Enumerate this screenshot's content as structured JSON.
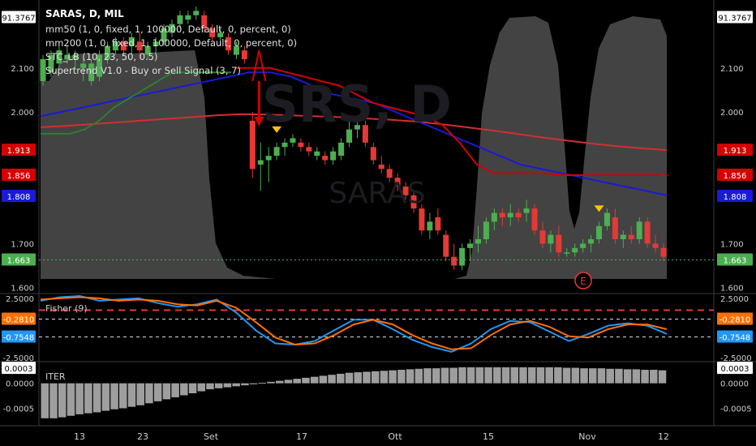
{
  "symbol": "SARAS, D, MIL",
  "watermark": {
    "big": "SRS, D",
    "small": "SARAS"
  },
  "indicators": [
    "mm50 (1, 0, fixed, 1, 100000, Default, 0, percent, 0)",
    "mm200 (1, 0, fixed, 1, 100000, Default, 0, percent, 0)",
    "STC_LB (10, 23, 50, 0.5)",
    "Supertrend V1.0 - Buy or Sell Signal (3, 7)"
  ],
  "earnings_marker": "E",
  "colors": {
    "up": "#4caf50",
    "down": "#e53935",
    "mm50": "#1a1ad8",
    "mm200": "#d32f2f",
    "supertrend_up": "#2e7d32",
    "supertrend_down": "#d50000",
    "fisher1": "#2196f3",
    "fisher2": "#ff6f00",
    "stc": "#7a7a7a",
    "iter": "#9e9e9e",
    "signal": "#ffc107"
  },
  "chart_data": [
    {
      "type": "candlestick",
      "title": "SARAS, D, MIL",
      "x_labels": [
        "13",
        "23",
        "Set",
        "17",
        "Ott",
        "15",
        "Nov",
        "12"
      ],
      "ylim": [
        1.59,
        2.24
      ],
      "y_ticks": [
        "2.100",
        "2.000",
        "1.700",
        "1.600"
      ],
      "price_labels": [
        {
          "text": "91.3767",
          "value": 2.215,
          "color": "#ffffff",
          "bg": "#ffffff",
          "fg": "#000000"
        },
        {
          "text": "1.913",
          "value": 1.913,
          "bg": "#d50000",
          "fg": "#ffffff"
        },
        {
          "text": "1.856",
          "value": 1.856,
          "bg": "#d50000",
          "fg": "#ffffff"
        },
        {
          "text": "1.808",
          "value": 1.808,
          "bg": "#1a1ad8",
          "fg": "#ffffff"
        },
        {
          "text": "1.663",
          "value": 1.663,
          "bg": "#4caf50",
          "fg": "#ffffff"
        }
      ],
      "candles": [
        [
          2.07,
          2.13,
          2.06,
          2.12
        ],
        [
          2.09,
          2.14,
          2.08,
          2.13
        ],
        [
          2.11,
          2.15,
          2.1,
          2.14
        ],
        [
          2.12,
          2.15,
          2.11,
          2.13
        ],
        [
          2.12,
          2.14,
          2.1,
          2.13
        ],
        [
          2.1,
          2.12,
          2.07,
          2.11
        ],
        [
          2.07,
          2.12,
          2.06,
          2.11
        ],
        [
          2.08,
          2.14,
          2.07,
          2.13
        ],
        [
          2.12,
          2.16,
          2.11,
          2.15
        ],
        [
          2.14,
          2.17,
          2.13,
          2.16
        ],
        [
          2.16,
          2.17,
          2.13,
          2.14
        ],
        [
          2.15,
          2.18,
          2.13,
          2.17
        ],
        [
          2.16,
          2.18,
          2.12,
          2.14
        ],
        [
          2.13,
          2.16,
          2.12,
          2.15
        ],
        [
          2.15,
          2.17,
          2.13,
          2.16
        ],
        [
          2.16,
          2.2,
          2.15,
          2.19
        ],
        [
          2.18,
          2.21,
          2.17,
          2.2
        ],
        [
          2.2,
          2.23,
          2.19,
          2.22
        ],
        [
          2.21,
          2.23,
          2.2,
          2.22
        ],
        [
          2.22,
          2.24,
          2.21,
          2.23
        ],
        [
          2.22,
          2.23,
          2.18,
          2.19
        ],
        [
          2.19,
          2.2,
          2.16,
          2.17
        ],
        [
          2.17,
          2.19,
          2.15,
          2.18
        ],
        [
          2.17,
          2.18,
          2.13,
          2.14
        ],
        [
          2.13,
          2.16,
          2.12,
          2.15
        ],
        [
          2.14,
          2.15,
          2.11,
          2.12
        ],
        [
          1.98,
          2.0,
          1.85,
          1.87
        ],
        [
          1.88,
          1.93,
          1.82,
          1.89
        ],
        [
          1.89,
          1.92,
          1.84,
          1.9
        ],
        [
          1.9,
          1.93,
          1.89,
          1.92
        ],
        [
          1.92,
          1.94,
          1.9,
          1.93
        ],
        [
          1.93,
          1.95,
          1.92,
          1.94
        ],
        [
          1.93,
          1.94,
          1.91,
          1.92
        ],
        [
          1.92,
          1.93,
          1.9,
          1.91
        ],
        [
          1.9,
          1.92,
          1.89,
          1.91
        ],
        [
          1.9,
          1.91,
          1.88,
          1.89
        ],
        [
          1.89,
          1.92,
          1.88,
          1.91
        ],
        [
          1.9,
          1.94,
          1.89,
          1.93
        ],
        [
          1.93,
          1.98,
          1.92,
          1.96
        ],
        [
          1.96,
          1.98,
          1.94,
          1.97
        ],
        [
          1.97,
          1.98,
          1.92,
          1.93
        ],
        [
          1.92,
          1.93,
          1.88,
          1.89
        ],
        [
          1.88,
          1.9,
          1.86,
          1.87
        ],
        [
          1.87,
          1.88,
          1.84,
          1.85
        ],
        [
          1.85,
          1.86,
          1.82,
          1.83
        ],
        [
          1.83,
          1.84,
          1.8,
          1.81
        ],
        [
          1.81,
          1.82,
          1.77,
          1.78
        ],
        [
          1.78,
          1.79,
          1.72,
          1.73
        ],
        [
          1.73,
          1.77,
          1.71,
          1.75
        ],
        [
          1.76,
          1.78,
          1.72,
          1.73
        ],
        [
          1.72,
          1.73,
          1.66,
          1.67
        ],
        [
          1.67,
          1.7,
          1.64,
          1.65
        ],
        [
          1.65,
          1.7,
          1.64,
          1.69
        ],
        [
          1.69,
          1.71,
          1.66,
          1.7
        ],
        [
          1.7,
          1.74,
          1.68,
          1.71
        ],
        [
          1.71,
          1.76,
          1.7,
          1.75
        ],
        [
          1.75,
          1.78,
          1.73,
          1.77
        ],
        [
          1.77,
          1.78,
          1.74,
          1.76
        ],
        [
          1.76,
          1.79,
          1.74,
          1.77
        ],
        [
          1.77,
          1.78,
          1.75,
          1.76
        ],
        [
          1.77,
          1.8,
          1.75,
          1.78
        ],
        [
          1.78,
          1.79,
          1.72,
          1.73
        ],
        [
          1.73,
          1.75,
          1.69,
          1.7
        ],
        [
          1.7,
          1.73,
          1.68,
          1.72
        ],
        [
          1.72,
          1.74,
          1.67,
          1.68
        ],
        [
          1.68,
          1.69,
          1.67,
          1.68
        ],
        [
          1.68,
          1.7,
          1.67,
          1.69
        ],
        [
          1.69,
          1.71,
          1.68,
          1.7
        ],
        [
          1.7,
          1.72,
          1.68,
          1.71
        ],
        [
          1.71,
          1.75,
          1.7,
          1.74
        ],
        [
          1.74,
          1.78,
          1.73,
          1.77
        ],
        [
          1.76,
          1.78,
          1.7,
          1.71
        ],
        [
          1.71,
          1.73,
          1.69,
          1.72
        ],
        [
          1.72,
          1.74,
          1.7,
          1.71
        ],
        [
          1.71,
          1.76,
          1.7,
          1.75
        ],
        [
          1.75,
          1.76,
          1.69,
          1.7
        ],
        [
          1.7,
          1.72,
          1.68,
          1.69
        ],
        [
          1.69,
          1.7,
          1.66,
          1.67
        ]
      ],
      "mm50": [
        1.99,
        2.0,
        2.01,
        2.02,
        2.03,
        2.04,
        2.05,
        2.06,
        2.07,
        2.08,
        2.09,
        2.09,
        2.08,
        2.06,
        2.04,
        2.03,
        2.02,
        2.0,
        1.98,
        1.96,
        1.94,
        1.92,
        1.9,
        1.88,
        1.87,
        1.86,
        1.85,
        1.84,
        1.83,
        1.82,
        1.81
      ],
      "mm200": [
        1.965,
        1.968,
        1.972,
        1.976,
        1.98,
        1.984,
        1.988,
        1.992,
        1.995,
        1.994,
        1.992,
        1.99,
        1.988,
        1.985,
        1.982,
        1.978,
        1.972,
        1.965,
        1.958,
        1.95,
        1.942,
        1.935,
        1.928,
        1.922,
        1.917,
        1.913
      ],
      "supertrend": {
        "up": [
          1.95,
          1.95,
          1.95,
          1.96,
          1.98,
          2.01,
          2.03,
          2.05,
          2.07,
          2.09,
          2.09,
          2.09,
          2.09,
          2.09
        ],
        "down": [
          2.1,
          2.1,
          2.1,
          2.09,
          2.08,
          2.07,
          2.06,
          2.04,
          2.02,
          2.01,
          2.0,
          1.99,
          1.97,
          1.93,
          1.88,
          1.86,
          1.86,
          1.86,
          1.86,
          1.856,
          1.856,
          1.856,
          1.856,
          1.856,
          1.856,
          1.856
        ]
      },
      "signals": {
        "sell": [
          19,
          29,
          69
        ],
        "big_sell_arrow": 26
      }
    },
    {
      "type": "line",
      "title": "Fisher (9)",
      "ylim": [
        -2.7,
        2.7
      ],
      "y_ticks": [
        "2.5000",
        "-2.5000"
      ],
      "levels": [
        1.5,
        0.75,
        -0.75
      ],
      "price_labels": [
        {
          "text": "-0.2810",
          "value": 0.75,
          "bg": "#ff6f00",
          "fg": "#ffffff"
        },
        {
          "text": "-0.7548",
          "value": -0.75,
          "bg": "#2196f3",
          "fg": "#ffffff"
        }
      ],
      "series": [
        {
          "name": "Fisher",
          "values": [
            2.3,
            2.6,
            2.7,
            2.3,
            2.4,
            2.5,
            2.1,
            1.8,
            2.0,
            2.4,
            1.3,
            -0.2,
            -1.3,
            -1.4,
            -1.1,
            -0.2,
            0.7,
            0.7,
            -0.1,
            -1.0,
            -1.6,
            -2.0,
            -1.3,
            -0.1,
            0.6,
            0.5,
            -0.3,
            -1.1,
            -0.5,
            0.2,
            0.4,
            0.2,
            -0.5
          ]
        },
        {
          "name": "Trigger",
          "values": [
            2.4,
            2.5,
            2.6,
            2.5,
            2.3,
            2.4,
            2.3,
            2.0,
            1.9,
            2.3,
            1.7,
            0.5,
            -0.8,
            -1.4,
            -1.3,
            -0.6,
            0.3,
            0.7,
            0.3,
            -0.6,
            -1.3,
            -1.8,
            -1.7,
            -0.6,
            0.3,
            0.6,
            0.1,
            -0.7,
            -0.8,
            -0.1,
            0.3,
            0.3,
            -0.1
          ]
        }
      ]
    },
    {
      "type": "bar",
      "title": "ITER",
      "ylim": [
        -0.0008,
        0.0004
      ],
      "y_ticks": [
        "0.0003",
        "0.0000",
        "-0.0005"
      ],
      "price_labels": [
        {
          "text": "0.0003",
          "value": 0.0003,
          "bg": "#ffffff",
          "fg": "#000000"
        }
      ],
      "values": [
        -0.0007,
        -0.0007,
        -0.00068,
        -0.00065,
        -0.00062,
        -0.0006,
        -0.00058,
        -0.00055,
        -0.00052,
        -0.0005,
        -0.00047,
        -0.00044,
        -0.0004,
        -0.00036,
        -0.00032,
        -0.00028,
        -0.00024,
        -0.0002,
        -0.00016,
        -0.00012,
        -0.0001,
        -8e-05,
        -6e-05,
        -4e-05,
        -2e-05,
        1e-05,
        3e-05,
        5e-05,
        7e-05,
        9e-05,
        0.00011,
        0.00013,
        0.00015,
        0.00017,
        0.00019,
        0.00021,
        0.00022,
        0.00023,
        0.00024,
        0.00025,
        0.00026,
        0.00027,
        0.00028,
        0.00029,
        0.0003,
        0.0003,
        0.00031,
        0.00031,
        0.00032,
        0.00032,
        0.00032,
        0.00032,
        0.00032,
        0.00032,
        0.00032,
        0.00032,
        0.00032,
        0.00032,
        0.00032,
        0.00032,
        0.00031,
        0.00031,
        0.0003,
        0.0003,
        0.0003,
        0.00029,
        0.00029,
        0.00028,
        0.00028,
        0.00027,
        0.00027,
        0.00026
      ]
    }
  ]
}
